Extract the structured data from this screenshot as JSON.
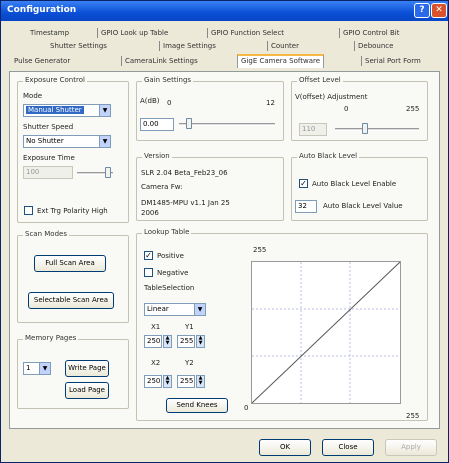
{
  "window": {
    "title": "Configuration"
  },
  "tabs": {
    "row1": [
      "Timestamp",
      "GPIO Look up Table",
      "GPIO Function Select",
      "GPIO Control Bit"
    ],
    "row2": [
      "Shutter Settings",
      "Image Settings",
      "Counter",
      "Debounce"
    ],
    "row3": [
      "Pulse Generator",
      "CameraLink Settings",
      "GigE Camera Software",
      "Serial Port Form"
    ]
  },
  "exposure": {
    "title": "Exposure Control",
    "mode_label": "Mode",
    "mode_value": "Manual Shutter",
    "shutter_label": "Shutter Speed",
    "shutter_value": "No Shutter",
    "time_label": "Exposure Time",
    "time_value": "100",
    "ext_trig_label": "Ext Trg Polarity High",
    "ext_trig_checked": false
  },
  "gain": {
    "title": "Gain Settings",
    "label": "A(dB)",
    "min": "0",
    "max": "12",
    "value": "0.00"
  },
  "offset": {
    "title": "Offset Level",
    "label": "V(offset) Adjustment",
    "min": "0",
    "max": "255",
    "value": "110"
  },
  "version": {
    "title": "Version",
    "line1": "SLR   2.04 Beta_Feb23_06",
    "line2": "Camera Fw:",
    "line3": "DM1485-MPU v1.1   Jan 25",
    "line4": "2006"
  },
  "auto_black": {
    "title": "Auto Black Level",
    "enable_label": "Auto Black Level Enable",
    "enable_checked": true,
    "value": "32",
    "value_label": "Auto Black Level Value"
  },
  "scan": {
    "title": "Scan Modes",
    "full_label": "Full Scan Area",
    "select_label": "Selectable Scan Area"
  },
  "memory": {
    "title": "Memory Pages",
    "page_value": "1",
    "write_label": "Write Page",
    "load_label": "Load Page"
  },
  "lut": {
    "title": "Lookup Table",
    "positive_label": "Positive",
    "positive_checked": true,
    "negative_label": "Negative",
    "negative_checked": false,
    "table_label": "TableSelection",
    "table_value": "Linear",
    "x1_label": "X1",
    "y1_label": "Y1",
    "x1": "250",
    "y1": "255",
    "x2_label": "X2",
    "y2_label": "Y2",
    "x2": "250",
    "y2": "255",
    "send_label": "Send Knees",
    "plot_top": "255",
    "plot_right": "255",
    "plot_origin": "0"
  },
  "footer": {
    "ok_label": "OK",
    "close_label": "Close",
    "apply_label": "Apply"
  }
}
